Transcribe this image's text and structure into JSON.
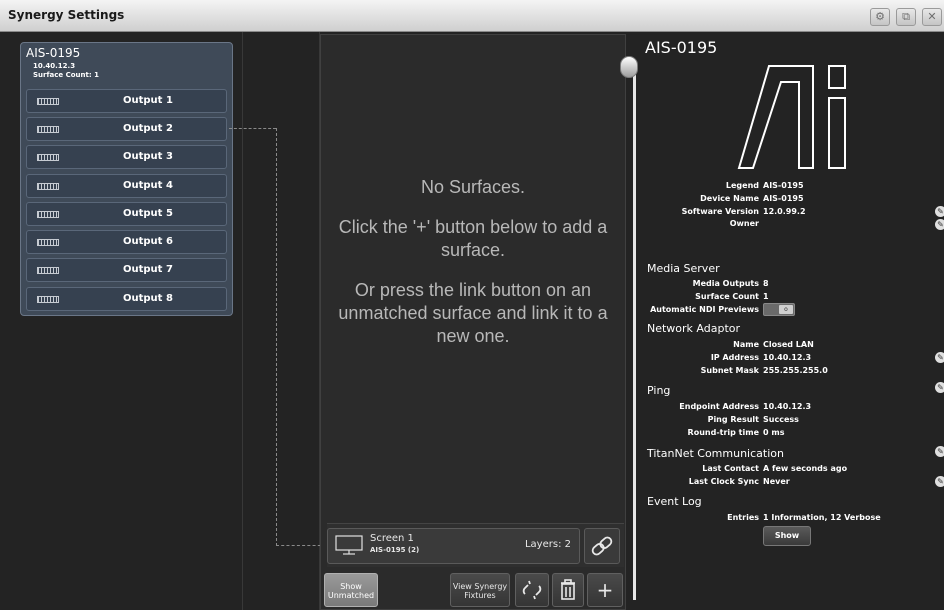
{
  "window": {
    "title": "Synergy Settings",
    "buttons": [
      {
        "icon": "gear-icon",
        "glyph": "⚙"
      },
      {
        "icon": "restore-icon",
        "glyph": "⧉"
      },
      {
        "icon": "close-icon",
        "glyph": "✕"
      }
    ]
  },
  "device": {
    "name": "AIS-0195",
    "ip": "10.40.12.3",
    "surface_count": "Surface Count: 1",
    "outputs": [
      "Output 1",
      "Output 2",
      "Output 3",
      "Output 4",
      "Output 5",
      "Output 6",
      "Output 7",
      "Output 8"
    ]
  },
  "surfaces": {
    "message_1": "No Surfaces.",
    "message_2": "Click the '+' button below to add a surface.",
    "message_3": "Or press the link button on an unmatched surface and link it to a new one."
  },
  "screen": {
    "name": "Screen 1",
    "sub": "AIS-0195 (2)",
    "layers": "Layers: 2"
  },
  "toolbar": {
    "show_unmatched_1": "Show",
    "show_unmatched_2": "Unmatched",
    "view_fixtures_1": "View Synergy",
    "view_fixtures_2": "Fixtures",
    "add_glyph": "+"
  },
  "info": {
    "title": "AIS-0195",
    "top_props": [
      {
        "key": "Legend",
        "value": "AIS-0195"
      },
      {
        "key": "Device Name",
        "value": "AIS-0195"
      },
      {
        "key": "Software Version",
        "value": "12.0.99.2"
      },
      {
        "key": "Owner",
        "value": ""
      }
    ],
    "media_server": {
      "heading": "Media Server",
      "props": [
        {
          "key": "Media Outputs",
          "value": "8"
        },
        {
          "key": "Surface Count",
          "value": "1"
        },
        {
          "key": "Automatic NDI Previews",
          "value": ""
        }
      ],
      "ndi_toggle_on": false
    },
    "network_adaptor": {
      "heading": "Network Adaptor",
      "props": [
        {
          "key": "Name",
          "value": "Closed LAN"
        },
        {
          "key": "IP Address",
          "value": "10.40.12.3"
        },
        {
          "key": "Subnet Mask",
          "value": "255.255.255.0"
        }
      ]
    },
    "ping": {
      "heading": "Ping",
      "props": [
        {
          "key": "Endpoint Address",
          "value": "10.40.12.3"
        },
        {
          "key": "Ping Result",
          "value": "Success"
        },
        {
          "key": "Round-trip time",
          "value": "0 ms"
        }
      ]
    },
    "titannet": {
      "heading": "TitanNet Communication",
      "props": [
        {
          "key": "Last Contact",
          "value": "A few seconds ago"
        },
        {
          "key": "Last Clock Sync",
          "value": "Never"
        }
      ]
    },
    "event_log": {
      "heading": "Event Log",
      "props": [
        {
          "key": "Entries",
          "value": "1 Information, 12 Verbose"
        }
      ],
      "show_label": "Show"
    }
  }
}
